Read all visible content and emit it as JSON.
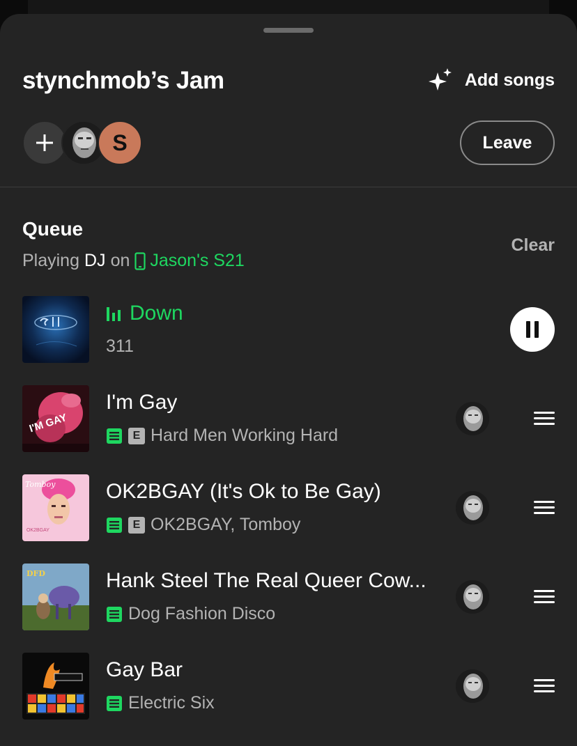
{
  "header": {
    "title": "stynchmob’s Jam",
    "add_songs_label": "Add songs",
    "leave_label": "Leave"
  },
  "participants": {
    "add_icon": "plus-icon",
    "members": [
      {
        "type": "photo"
      },
      {
        "type": "initial",
        "initial": "S",
        "color": "#c9795a"
      }
    ]
  },
  "queue": {
    "title": "Queue",
    "playing_prefix": "Playing",
    "playing_source": "DJ",
    "playing_on": "on",
    "device_name": "Jason's S21",
    "clear_label": "Clear"
  },
  "now_playing": {
    "title": "Down",
    "artist": "311",
    "state": "playing"
  },
  "tracks": [
    {
      "title": "I'm Gay",
      "subtitle": "Hard Men Working Hard",
      "explicit": true,
      "downloaded": true
    },
    {
      "title": "OK2BGAY (It's Ok to Be Gay)",
      "subtitle": "OK2BGAY, Tomboy",
      "explicit": true,
      "downloaded": true
    },
    {
      "title": "Hank Steel The Real Queer Cow...",
      "subtitle": "Dog Fashion Disco",
      "explicit": false,
      "downloaded": true
    },
    {
      "title": "Gay Bar",
      "subtitle": "Electric Six",
      "explicit": false,
      "downloaded": true
    }
  ],
  "colors": {
    "accent": "#1ed760",
    "background": "#242424",
    "secondary_text": "#b3b3b3"
  }
}
